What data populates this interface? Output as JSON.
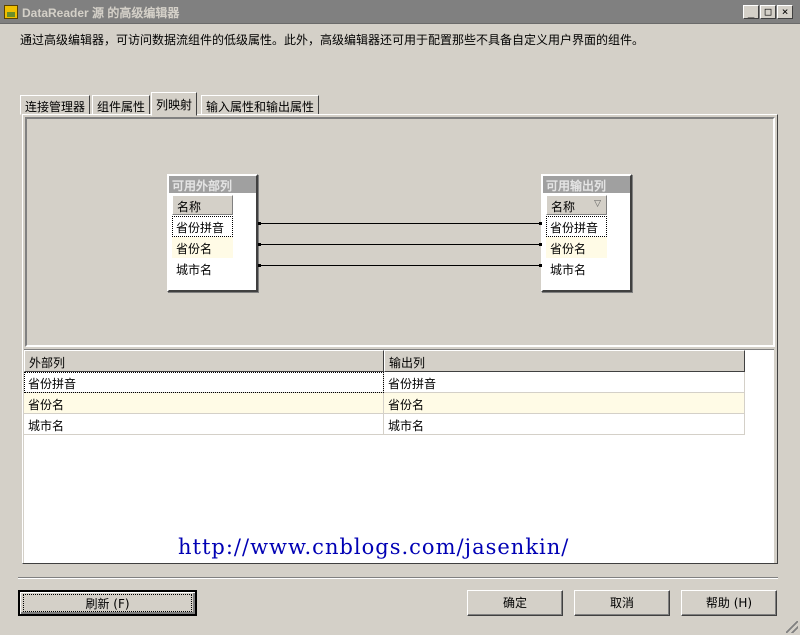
{
  "window": {
    "title": "DataReader 源 的高级编辑器",
    "min_glyph": "_",
    "max_glyph": "□",
    "close_glyph": "×"
  },
  "description": "通过高级编辑器，可访问数据流组件的低级属性。此外，高级编辑器还可用于配置那些不具备自定义用户界面的组件。",
  "tabs": [
    {
      "label": "连接管理器",
      "active": false
    },
    {
      "label": "组件属性",
      "active": false
    },
    {
      "label": "列映射",
      "active": true
    },
    {
      "label": "输入属性和输出属性",
      "active": false
    }
  ],
  "external_box": {
    "title": "可用外部列",
    "header": "名称",
    "rows": [
      "省份拼音",
      "省份名",
      "城市名"
    ]
  },
  "output_box": {
    "title": "可用输出列",
    "header": "名称",
    "sort_icon": "▽",
    "rows": [
      "省份拼音",
      "省份名",
      "城市名"
    ]
  },
  "grid": {
    "headers": [
      "外部列",
      "输出列"
    ],
    "rows": [
      [
        "省份拼音",
        "省份拼音"
      ],
      [
        "省份名",
        "省份名"
      ],
      [
        "城市名",
        "城市名"
      ]
    ]
  },
  "watermark": "http://www.cnblogs.com/jasenkin/",
  "buttons": {
    "refresh": "刷新 (F)",
    "ok": "确定",
    "cancel": "取消",
    "help": "帮助 (H)"
  }
}
